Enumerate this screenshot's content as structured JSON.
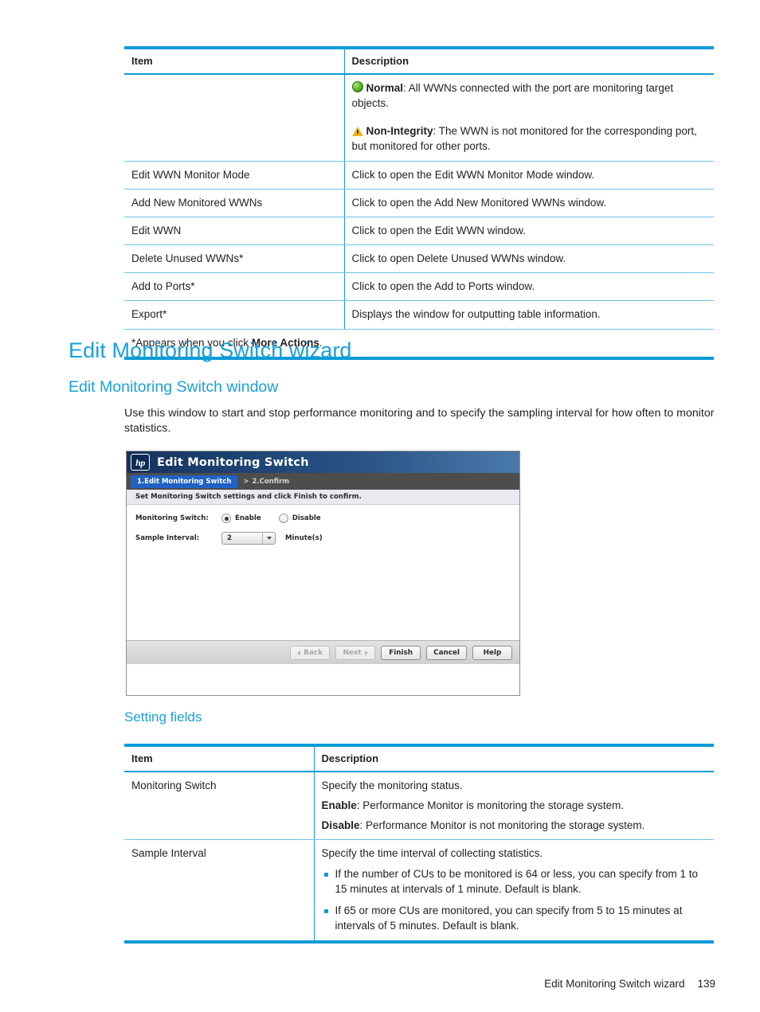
{
  "tables": {
    "wwn_actions": {
      "headers": [
        "Item",
        "Description"
      ],
      "status_rows": {
        "normal_icon": "green-circle-icon",
        "normal_label": "Normal",
        "normal_text": ": All WWNs connected with the port are monitoring target objects.",
        "warning_icon": "warning-triangle-icon",
        "warning_label": "Non-Integrity",
        "warning_text": ": The WWN is not monitored for the corresponding port, but monitored for other ports."
      },
      "rows": [
        {
          "item": "Edit WWN Monitor Mode",
          "description": "Click to open the Edit WWN Monitor Mode window."
        },
        {
          "item": "Add New Monitored WWNs",
          "description": "Click to open the Add New Monitored WWNs window."
        },
        {
          "item": "Edit WWN",
          "description": "Click to open the Edit WWN window."
        },
        {
          "item": "Delete Unused WWNs*",
          "description": "Click to open Delete Unused WWNs window."
        },
        {
          "item": "Add to Ports*",
          "description": "Click to open the Add to Ports window."
        },
        {
          "item": "Export*",
          "description": "Displays the window for outputting table information."
        }
      ],
      "footnote_prefix": "*Appears when you click ",
      "footnote_bold": "More Actions",
      "footnote_suffix": "."
    },
    "setting_fields": {
      "headers": [
        "Item",
        "Description"
      ],
      "row_monitoring_switch": {
        "item": "Monitoring Switch",
        "line1": "Specify the monitoring status.",
        "enable_label": "Enable",
        "enable_text": ": Performance Monitor is monitoring the storage system.",
        "disable_label": "Disable",
        "disable_text": ": Performance Monitor is not monitoring the storage system."
      },
      "row_sample_interval": {
        "item": "Sample Interval",
        "line1": "Specify the time interval of collecting statistics.",
        "bullets": [
          "If the number of CUs to be monitored is 64 or less, you can specify from 1 to 15 minutes at intervals of 1 minute. Default is blank.",
          "If 65 or more CUs are monitored, you can specify from 5 to 15 minutes at intervals of 5 minutes. Default is blank."
        ]
      }
    }
  },
  "headings": {
    "h1": "Edit Monitoring Switch wizard",
    "h2": "Edit Monitoring Switch window",
    "h3": "Setting fields"
  },
  "intro": "Use this window to start and stop performance monitoring and to specify the sampling interval for how often to monitor statistics.",
  "dialog": {
    "logo_text": "hp",
    "title": "Edit Monitoring Switch",
    "step_active": "1.Edit Monitoring Switch",
    "step_separator": ">",
    "step_next": "2.Confirm",
    "instruction": "Set Monitoring Switch settings and click Finish to confirm.",
    "monitoring_switch": {
      "label": "Monitoring Switch:",
      "enable": "Enable",
      "disable": "Disable",
      "selected": "Enable"
    },
    "sample_interval": {
      "label": "Sample Interval:",
      "value": "2",
      "unit": "Minute(s)"
    },
    "buttons": {
      "back": "Back",
      "next": "Next",
      "finish": "Finish",
      "cancel": "Cancel",
      "help": "Help"
    }
  },
  "footer": {
    "text": "Edit Monitoring Switch wizard",
    "page_number": "139"
  },
  "colors": {
    "heading_blue": "#19a0dc",
    "table_rule": "#0a9bd8",
    "dialog_step_active": "#2062c4",
    "status_normal": "#5cba28",
    "status_warning": "#f2b51c"
  }
}
